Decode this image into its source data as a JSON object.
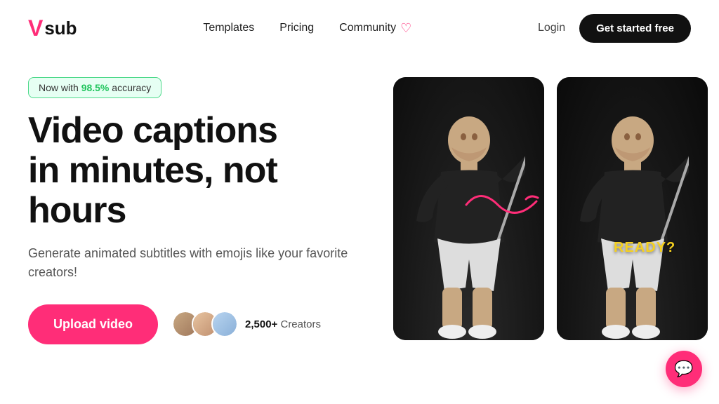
{
  "header": {
    "logo_v": "V",
    "logo_sub": "sub",
    "nav": {
      "templates": "Templates",
      "pricing": "Pricing",
      "community": "Community",
      "community_icon": "♡"
    },
    "login_label": "Login",
    "get_started_label": "Get started free"
  },
  "hero": {
    "badge_prefix": "Now with ",
    "badge_highlight": "98.5%",
    "badge_suffix": " accuracy",
    "title_line1": "Video captions",
    "title_line2": "in minutes, not",
    "title_line3": "hours",
    "subtitle": "Generate animated subtitles with emojis like your favorite creators!",
    "upload_btn": "Upload video",
    "creators_count": "2,500+",
    "creators_label": " Creators"
  },
  "video_cards": {
    "left_alt": "Video without caption",
    "right_caption": "READY?",
    "right_alt": "Video with caption overlay"
  },
  "chat": {
    "icon": "💬"
  }
}
